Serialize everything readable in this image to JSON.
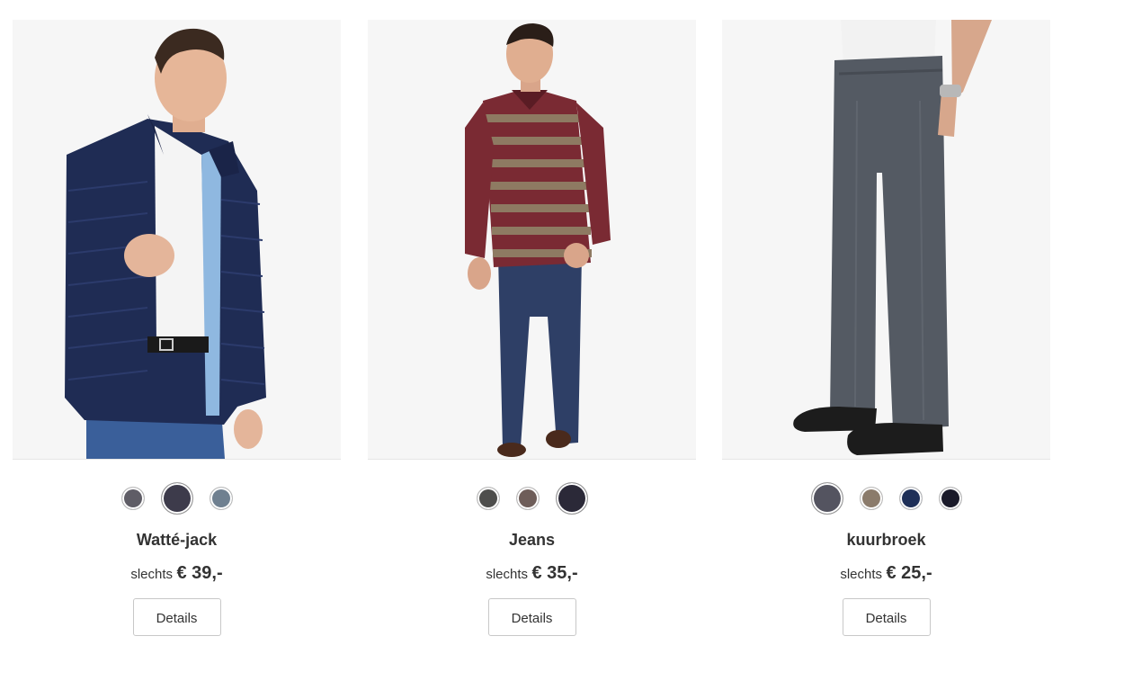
{
  "products": [
    {
      "name": "Watté-jack",
      "price_lead": "slechts",
      "price": "€ 39,-",
      "details_label": "Details",
      "image_subject": "man-in-navy-quilted-jacket",
      "swatches": [
        {
          "color": "#5f5d66",
          "selected": false
        },
        {
          "color": "#3d3b4b",
          "selected": true
        },
        {
          "color": "#6f8090",
          "selected": false
        }
      ]
    },
    {
      "name": "Jeans",
      "price_lead": "slechts",
      "price": "€ 35,-",
      "details_label": "Details",
      "image_subject": "man-in-burgundy-polo-and-jeans",
      "swatches": [
        {
          "color": "#4e4e4c",
          "selected": false
        },
        {
          "color": "#6e5d59",
          "selected": false
        },
        {
          "color": "#2b2938",
          "selected": true
        }
      ]
    },
    {
      "name": "kuurbroek",
      "price_lead": "slechts",
      "price": "€ 25,-",
      "details_label": "Details",
      "image_subject": "grey-trousers-with-black-shoes",
      "swatches": [
        {
          "color": "#545460",
          "selected": true
        },
        {
          "color": "#8b7b6b",
          "selected": false
        },
        {
          "color": "#1e2f58",
          "selected": false
        },
        {
          "color": "#1a1a2a",
          "selected": false
        }
      ]
    }
  ]
}
